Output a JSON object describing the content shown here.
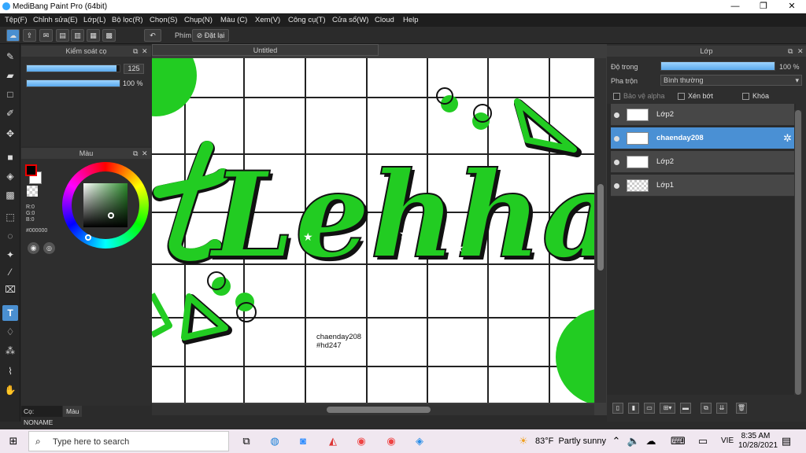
{
  "window": {
    "title": "MediBang Paint Pro (64bit)",
    "min": "—",
    "max": "❐",
    "close": "✕"
  },
  "menu": [
    "Tệp(F)",
    "Chỉnh sửa(E)",
    "Lớp(L)",
    "Bộ lọc(R)",
    "Chọn(S)",
    "Chụp(N)",
    "Màu (C)",
    "Xem(V)",
    "Công cụ(T)",
    "Cửa sổ(W)",
    "Cloud",
    "Help"
  ],
  "toolbar": {
    "key_label": "Phím",
    "reset_label": "Đặt lại"
  },
  "brush_panel": {
    "title": "Kiểm soát cọ",
    "size_value": "125",
    "opacity_value": "100 %",
    "size_fraction": 0.97,
    "opacity_fraction": 1.0
  },
  "color_panel": {
    "title": "Màu",
    "r": "R:0",
    "g": "G:0",
    "b": "B:0",
    "hex": "#000000",
    "foreground": "#000000",
    "background": "#ffffff"
  },
  "left_bottom_tabs": {
    "brush_tab": "Cọ: NONAME",
    "color_tab": "Màu"
  },
  "canvas": {
    "tab_title": "Untitled",
    "text_line1": "chaenday208",
    "text_line2": "#hd247",
    "artwork_text": "Lehha",
    "accent": "#22cc22"
  },
  "layer_panel": {
    "title": "Lớp",
    "opacity_label": "Độ trong",
    "opacity_value": "100 %",
    "opacity_fraction": 1.0,
    "blend_label": "Pha trộn",
    "blend_value": "Bình thường",
    "protect_alpha": "Bảo vệ alpha",
    "clip": "Xén bớt",
    "lock": "Khóa",
    "layers": [
      {
        "name": "Lớp2",
        "selected": false
      },
      {
        "name": "chaenday208",
        "selected": true
      },
      {
        "name": "Lớp2",
        "selected": false
      },
      {
        "name": "Lớp1",
        "selected": false
      }
    ]
  },
  "taskbar": {
    "search_placeholder": "Type here to search",
    "weather": "83°F  Partly sunny",
    "lang": "VIE",
    "time": "8:35 AM",
    "date": "10/28/2021"
  }
}
